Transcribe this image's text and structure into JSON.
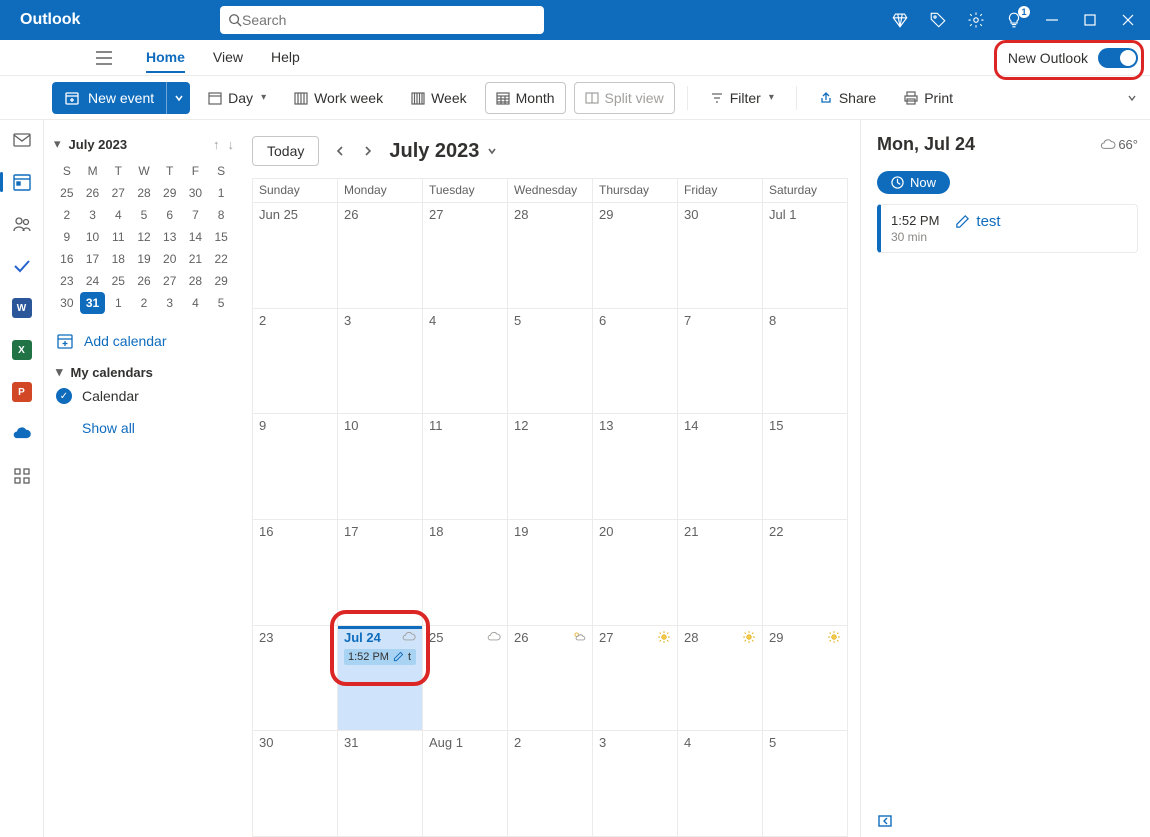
{
  "app": {
    "name": "Outlook"
  },
  "search": {
    "placeholder": "Search"
  },
  "titlebar": {
    "notification_badge": "1"
  },
  "ribbon": {
    "tabs": {
      "home": "Home",
      "view": "View",
      "help": "Help"
    },
    "new_outlook_label": "New Outlook"
  },
  "cmd": {
    "new_event": "New event",
    "day": "Day",
    "work_week": "Work week",
    "week": "Week",
    "month": "Month",
    "split_view": "Split view",
    "filter": "Filter",
    "share": "Share",
    "print": "Print"
  },
  "mini": {
    "month_title": "July 2023",
    "dow": [
      "S",
      "M",
      "T",
      "W",
      "T",
      "F",
      "S"
    ],
    "rows": [
      [
        "25",
        "26",
        "27",
        "28",
        "29",
        "30",
        "1"
      ],
      [
        "2",
        "3",
        "4",
        "5",
        "6",
        "7",
        "8"
      ],
      [
        "9",
        "10",
        "11",
        "12",
        "13",
        "14",
        "15"
      ],
      [
        "16",
        "17",
        "18",
        "19",
        "20",
        "21",
        "22"
      ],
      [
        "23",
        "24",
        "25",
        "26",
        "27",
        "28",
        "29"
      ],
      [
        "30",
        "31",
        "1",
        "2",
        "3",
        "4",
        "5"
      ]
    ],
    "today_index": [
      5,
      1
    ],
    "add_calendar": "Add calendar",
    "my_calendars": "My calendars",
    "calendar_item": "Calendar",
    "show_all": "Show all"
  },
  "main": {
    "today_btn": "Today",
    "month_title": "July 2023",
    "weekdays": [
      "Sunday",
      "Monday",
      "Tuesday",
      "Wednesday",
      "Thursday",
      "Friday",
      "Saturday"
    ],
    "rows": [
      [
        {
          "l": "Jun 25"
        },
        {
          "l": "26"
        },
        {
          "l": "27"
        },
        {
          "l": "28"
        },
        {
          "l": "29"
        },
        {
          "l": "30"
        },
        {
          "l": "Jul 1"
        }
      ],
      [
        {
          "l": "2"
        },
        {
          "l": "3"
        },
        {
          "l": "4"
        },
        {
          "l": "5"
        },
        {
          "l": "6"
        },
        {
          "l": "7"
        },
        {
          "l": "8"
        }
      ],
      [
        {
          "l": "9"
        },
        {
          "l": "10"
        },
        {
          "l": "11"
        },
        {
          "l": "12"
        },
        {
          "l": "13"
        },
        {
          "l": "14"
        },
        {
          "l": "15"
        }
      ],
      [
        {
          "l": "16"
        },
        {
          "l": "17"
        },
        {
          "l": "18"
        },
        {
          "l": "19"
        },
        {
          "l": "20"
        },
        {
          "l": "21"
        },
        {
          "l": "22"
        }
      ],
      [
        {
          "l": "23"
        },
        {
          "l": "Jul 24",
          "today": true,
          "weather": "cloud",
          "event": {
            "time": "1:52 PM",
            "title": "t"
          }
        },
        {
          "l": "25",
          "weather": "cloud"
        },
        {
          "l": "26",
          "weather": "partly"
        },
        {
          "l": "27",
          "weather": "sun"
        },
        {
          "l": "28",
          "weather": "sun"
        },
        {
          "l": "29",
          "weather": "sun"
        }
      ],
      [
        {
          "l": "30"
        },
        {
          "l": "31"
        },
        {
          "l": "Aug 1"
        },
        {
          "l": "2"
        },
        {
          "l": "3"
        },
        {
          "l": "4"
        },
        {
          "l": "5"
        }
      ]
    ]
  },
  "detail": {
    "title": "Mon, Jul 24",
    "temp": "66°",
    "now": "Now",
    "event": {
      "time": "1:52 PM",
      "duration": "30 min",
      "title": "test"
    }
  }
}
